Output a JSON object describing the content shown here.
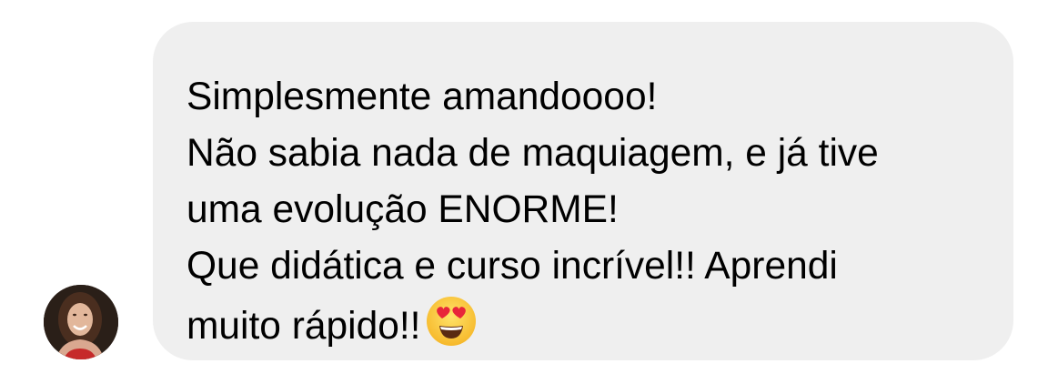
{
  "message": {
    "lines": [
      "Simplesmente amandoooo!",
      "Não sabia nada de maquiagem, e já tive",
      "uma evolução ENORME!",
      "Que didática e curso incrível!! Aprendi",
      "muito rápido!!"
    ],
    "emoji": "heart-eyes-emoji"
  },
  "colors": {
    "bubble": "#efefef",
    "text": "#000000",
    "background": "#ffffff"
  }
}
